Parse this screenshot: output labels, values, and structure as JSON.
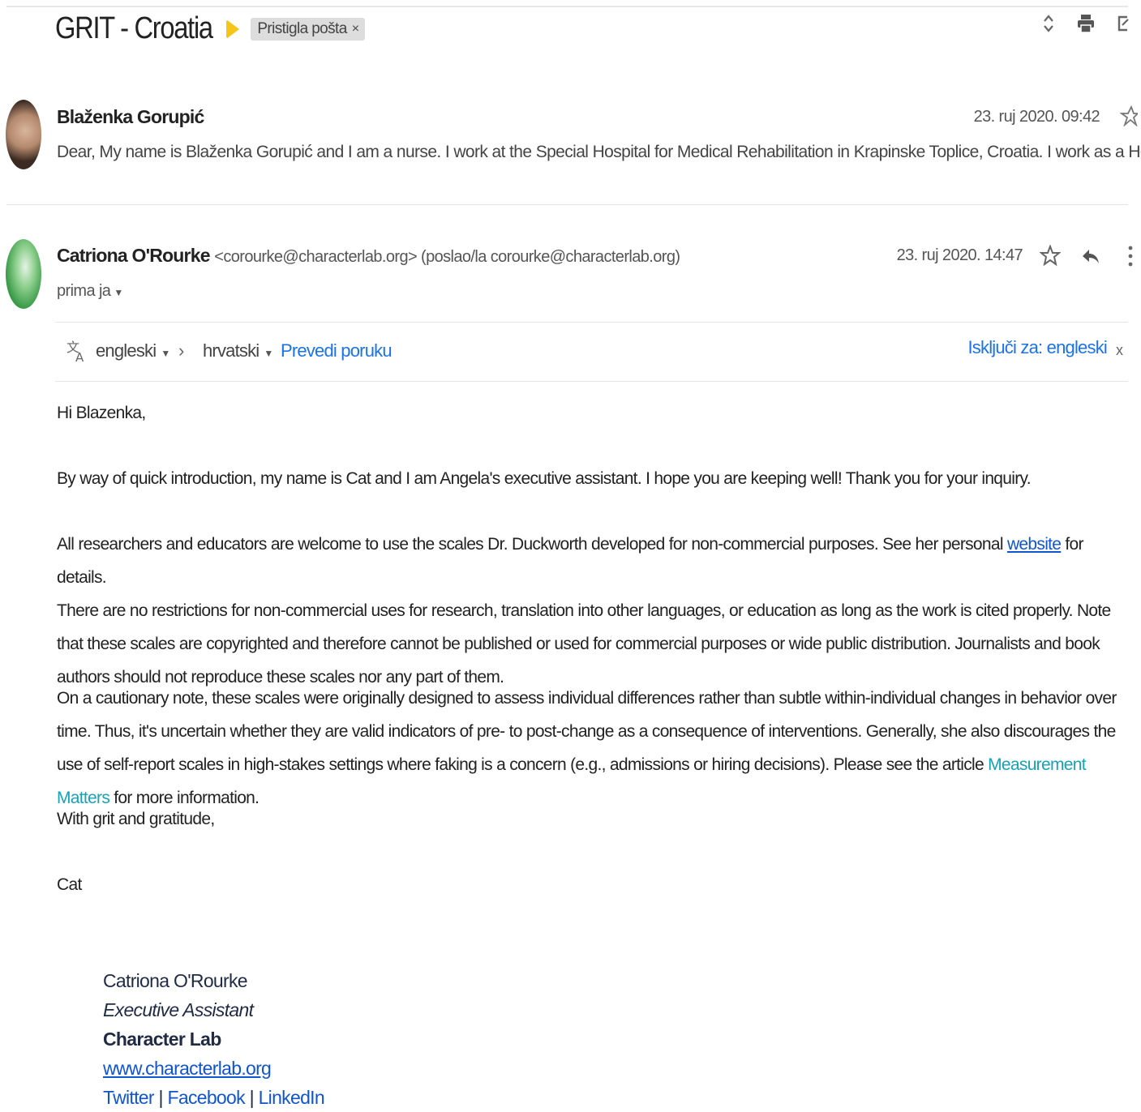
{
  "thread": {
    "subject": "GRIT - Croatia",
    "label": "Pristigla pošta",
    "label_remove": "×"
  },
  "toolbar_icons": [
    "expand-collapse-icon",
    "print-icon",
    "open-new-window-icon"
  ],
  "messages": [
    {
      "sender": "Blaženka Gorupić",
      "date": "23. ruj 2020. 09:42",
      "snippet": "Dear, My name is Blaženka Gorupić and I am a nurse. I work at the Special Hospital for Medical Rehabilitation in Krapinske Toplice, Croatia. I work as a Head Nu"
    },
    {
      "sender": "Catriona O'Rourke",
      "sender_email": "<corourke@characterlab.org> (poslao/la corourke@characterlab.org)",
      "date": "23. ruj 2020. 14:47",
      "to": "prima ja"
    }
  ],
  "translate": {
    "from": "engleski",
    "to": "hrvatski",
    "action": "Prevedi poruku",
    "turn_off": "Isključi za: engleski",
    "close": "x"
  },
  "email_body": {
    "greeting": "Hi Blazenka,",
    "p1": "By way of quick introduction, my name is Cat and I am Angela's executive assistant. I hope you are keeping well! Thank you for your inquiry.",
    "p2_before": "All researchers and educators are welcome to use the scales Dr. Duckworth developed for non-commercial purposes. See her personal ",
    "p2_link": "website",
    "p2_after": " for details.",
    "p3": "There are no restrictions for non-commercial uses for research, translation into other languages, or education as long as the work is cited properly. Note that these scales are copyrighted and therefore cannot be published or used for commercial purposes or wide public distribution. Journalists and book authors should not reproduce these scales nor any part of them.",
    "p4_before": "On a cautionary note, these scales were originally designed to assess individual differences rather than subtle within-individual changes in behavior over time. Thus, it's uncertain whether they are valid indicators of pre- to post-change as a consequence of interventions. Generally, she also discourages the use of self-report scales in high-stakes settings where faking is a concern (e.g., admissions or hiring decisions). Please see the article ",
    "p4_link": "Measurement Matters",
    "p4_after": " for more information.",
    "closing": "With grit and gratitude,",
    "name": "Cat"
  },
  "signature": {
    "name": "Catriona O'Rourke",
    "title": "Executive Assistant",
    "org": "Character Lab",
    "website": "www.characterlab.org",
    "twitter": "Twitter",
    "sep1": " | ",
    "facebook": "Facebook",
    "sep2": " | ",
    "linkedin": "LinkedIn"
  }
}
